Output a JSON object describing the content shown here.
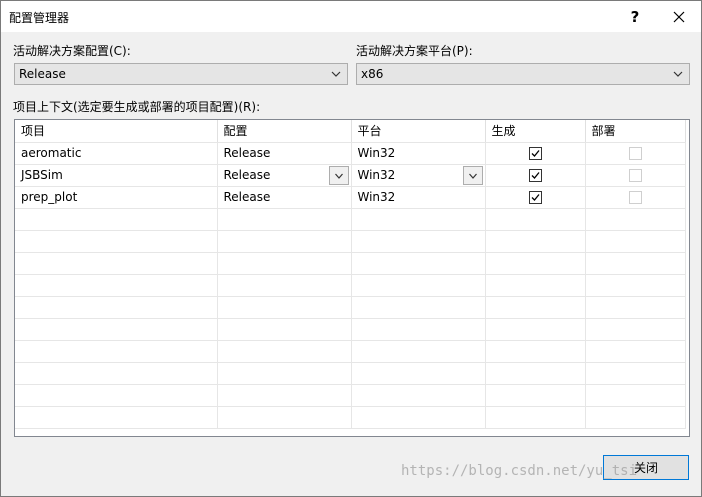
{
  "window": {
    "title": "配置管理器",
    "help_label": "?",
    "close_icon": "close-icon"
  },
  "active_config": {
    "label": "活动解决方案配置(C):",
    "value": "Release"
  },
  "active_platform": {
    "label": "活动解决方案平台(P):",
    "value": "x86"
  },
  "project_context_label": "项目上下文(选定要生成或部署的项目配置)(R):",
  "grid": {
    "columns": [
      "项目",
      "配置",
      "平台",
      "生成",
      "部署"
    ],
    "rows": [
      {
        "project": "aeromatic",
        "config": "Release",
        "platform": "Win32",
        "build": true,
        "deploy": false
      },
      {
        "project": "JSBSim",
        "config": "Release",
        "platform": "Win32",
        "build": true,
        "deploy": false
      },
      {
        "project": "prep_plot",
        "config": "Release",
        "platform": "Win32",
        "build": true,
        "deploy": false
      }
    ]
  },
  "close_button_label": "关闭",
  "watermark": "https://blog.csdn.net/yu_tsi"
}
